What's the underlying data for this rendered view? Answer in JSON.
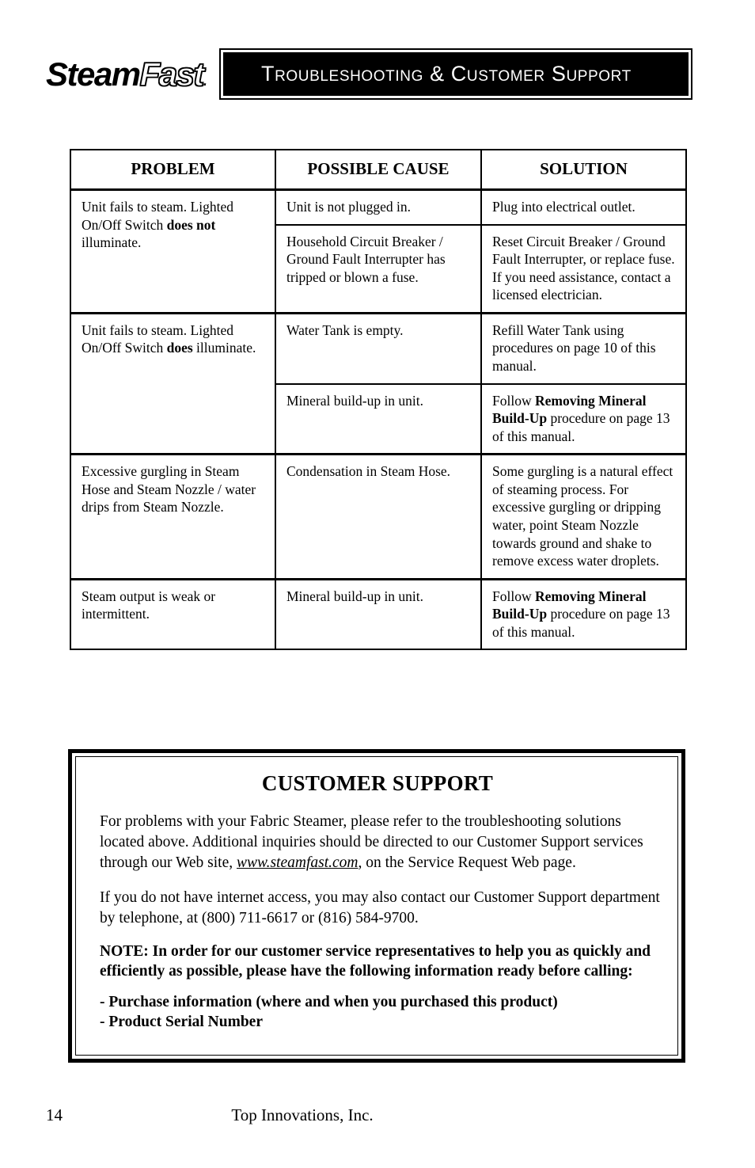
{
  "header": {
    "logo": {
      "part1": "Steam",
      "part2": "Fast",
      "mark": "."
    },
    "banner_title": "Troubleshooting & Customer Support"
  },
  "table": {
    "columns": [
      "PROBLEM",
      "POSSIBLE CAUSE",
      "SOLUTION"
    ],
    "groups": [
      {
        "problem_plain_1": "Unit fails to steam.  Lighted On/Off Switch ",
        "problem_bold": "does not",
        "problem_plain_2": " illuminate.",
        "rows": [
          {
            "cause": "Unit is not plugged in.",
            "solution_plain_1": "Plug into electrical outlet.",
            "solution_bold": "",
            "solution_plain_2": ""
          },
          {
            "cause": "Household Circuit Breaker / Ground Fault Interrupter has tripped or blown a fuse.",
            "solution_plain_1": "Reset Circuit Breaker / Ground Fault Interrupter, or replace fuse.  If you need assistance, contact a licensed electrician.",
            "solution_bold": "",
            "solution_plain_2": ""
          }
        ]
      },
      {
        "problem_plain_1": "Unit fails to steam.  Lighted On/Off Switch ",
        "problem_bold": "does",
        "problem_plain_2": " illuminate.",
        "rows": [
          {
            "cause": "Water Tank is empty.",
            "solution_plain_1": "Refill Water Tank using procedures on page 10 of this manual.",
            "solution_bold": "",
            "solution_plain_2": ""
          },
          {
            "cause": "Mineral build-up in unit.",
            "solution_plain_1": "Follow ",
            "solution_bold": "Removing Mineral Build-Up",
            "solution_plain_2": " procedure on page 13 of this manual."
          }
        ]
      },
      {
        "problem_plain_1": "Excessive gurgling in Steam Hose and Steam Nozzle / water drips from Steam Nozzle.",
        "problem_bold": "",
        "problem_plain_2": "",
        "rows": [
          {
            "cause": "Condensation in Steam Hose.",
            "solution_plain_1": "Some gurgling is a natural effect of steaming process.  For excessive gurgling or dripping water, point Steam Nozzle towards ground and shake to remove excess water droplets.",
            "solution_bold": "",
            "solution_plain_2": ""
          }
        ]
      },
      {
        "problem_plain_1": "Steam output is weak or intermittent.",
        "problem_bold": "",
        "problem_plain_2": "",
        "rows": [
          {
            "cause": "Mineral build-up in unit.",
            "solution_plain_1": "Follow ",
            "solution_bold": "Removing Mineral Build-Up",
            "solution_plain_2": " procedure on page 13 of this manual."
          }
        ]
      }
    ]
  },
  "customer_support": {
    "title": "CUSTOMER SUPPORT",
    "para1_before": "For problems with your Fabric Steamer, please refer to the troubleshooting solutions located above.  Additional inquiries should be directed to our Customer Support services through our Web site, ",
    "para1_url": "www.steamfast.com",
    "para1_after": ", on the Service Request Web page.",
    "para2": "If you do not have internet access, you may also contact our Customer Support department by telephone, at (800) 711-6617 or (816) 584-9700.",
    "note": "NOTE:  In order for our customer service representatives to help you as quickly and efficiently as possible, please have the following information ready before calling:",
    "bullet1": "- Purchase information (where and when you purchased this product)",
    "bullet2": "- Product Serial Number"
  },
  "footer": {
    "page_number": "14",
    "company": "Top Innovations, Inc."
  }
}
